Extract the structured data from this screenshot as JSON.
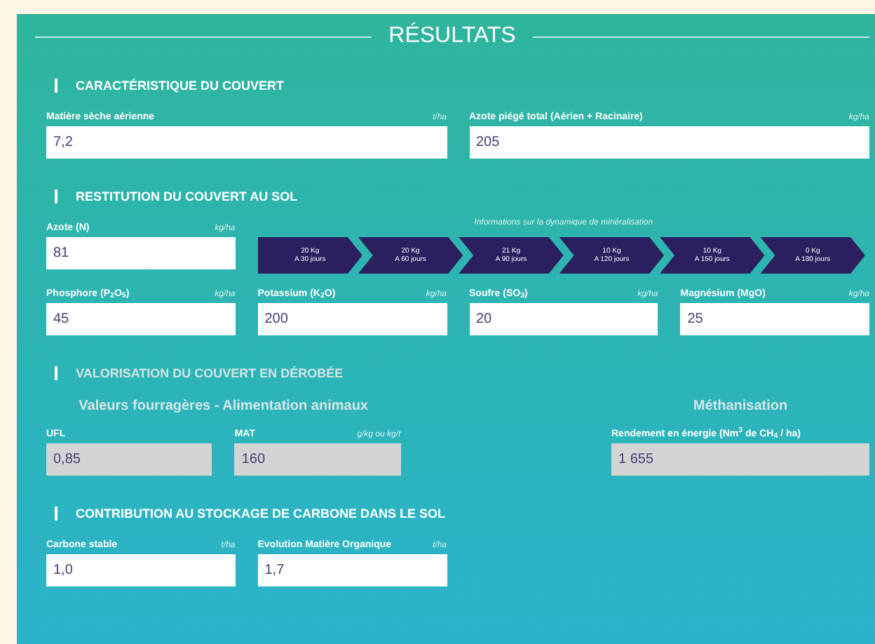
{
  "title": "RÉSULTATS",
  "sections": [
    {
      "kind": "pair",
      "heading": "CARACTÉRISTIQUE DU COUVERT",
      "disabled": false,
      "fields": [
        {
          "label": "Matière sèche aérienne",
          "unit": "t/ha",
          "value": "7,2",
          "disabled": false
        },
        {
          "label": "Azote piégé total (Aérien + Racinaire)",
          "unit": "kg/ha",
          "value": "205",
          "disabled": false
        }
      ]
    },
    {
      "kind": "restitution",
      "heading": "RESTITUTION DU COUVERT AU SOL",
      "disabled": false,
      "main_field": {
        "label": "Azote (N)",
        "unit": "kg/ha",
        "value": "81",
        "disabled": false
      },
      "mineralization": {
        "caption": "Informations sur la dynamique de minéralisation",
        "steps": [
          {
            "amount": "20 Kg",
            "period": "A 30 jours"
          },
          {
            "amount": "20 Kg",
            "period": "A 60 jours"
          },
          {
            "amount": "21 Kg",
            "period": "A 90 jours"
          },
          {
            "amount": "10 Kg",
            "period": "A 120 jours"
          },
          {
            "amount": "10 Kg",
            "period": "A 150 jours"
          },
          {
            "amount": "0 Kg",
            "period": "A 180 jours"
          }
        ]
      },
      "fields": [
        {
          "label": "Phosphore (P$_{2}$O$_{5}$)",
          "unit": "kg/ha",
          "value": "45",
          "disabled": false
        },
        {
          "label": "Potassium (K$_{2}$O)",
          "unit": "kg/ha",
          "value": "200",
          "disabled": false
        },
        {
          "label": "Soufre (SO$_{3}$)",
          "unit": "kg/ha",
          "value": "20",
          "disabled": false
        },
        {
          "label": "Magnésium (MgO)",
          "unit": "kg/ha",
          "value": "25",
          "disabled": false
        }
      ]
    },
    {
      "kind": "valorisation",
      "heading": "VALORISATION DU COUVERT EN DÉROBÉE",
      "disabled": true,
      "left": {
        "subheading": "Valeurs fourragères - Alimentation animaux",
        "fields": [
          {
            "label": "UFL",
            "value": "0,85",
            "disabled": true
          },
          {
            "label": "MAT",
            "unit": "g/kg ou kg/t",
            "value": "160",
            "disabled": true
          }
        ]
      },
      "right": {
        "subheading": "Méthanisation",
        "fields": [
          {
            "label": "Rendement en énergie (Nm$^{3}$ de CH$_{4}$ / ha)",
            "value": "1 655",
            "disabled": true
          }
        ]
      }
    },
    {
      "kind": "quad",
      "heading": "CONTRIBUTION AU STOCKAGE DE CARBONE DANS LE SOL",
      "disabled": false,
      "fields": [
        {
          "label": "Carbone stable",
          "unit": "t/ha",
          "value": "1,0",
          "disabled": false
        },
        {
          "label": "Evolution Matière Organique",
          "unit": "t/ha",
          "value": "1,7",
          "disabled": false
        }
      ]
    }
  ]
}
